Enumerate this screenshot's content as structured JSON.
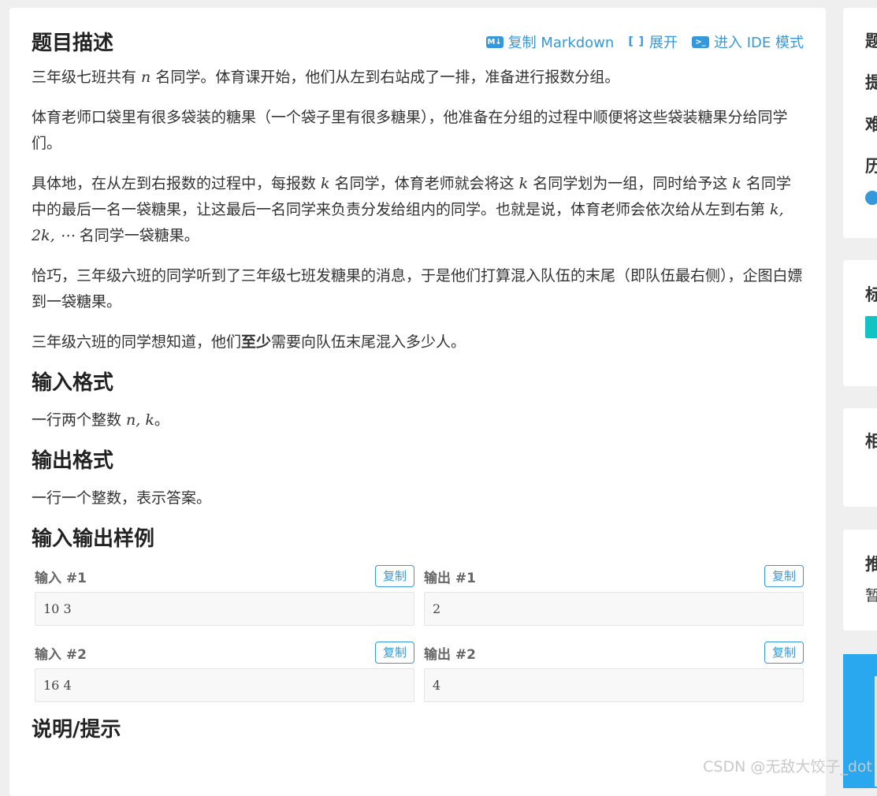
{
  "problem": {
    "title": "题目描述",
    "actions": {
      "copy_markdown": "复制 Markdown",
      "md_icon": "M↓",
      "expand": "展开",
      "expand_icon": "[ ]",
      "ide_mode": "进入 IDE 模式",
      "ide_icon": ">_"
    },
    "p1": {
      "a": "三年级七班共有 ",
      "n": "n",
      "b": " 名同学。体育课开始，他们从左到右站成了一排，准备进行报数分组。"
    },
    "p2": "体育老师口袋里有很多袋装的糖果（一个袋子里有很多糖果），他准备在分组的过程中顺便将这些袋装糖果分给同学们。",
    "p3": {
      "a": "具体地，在从左到右报数的过程中，每报数 ",
      "k1": "k",
      "b": " 名同学，体育老师就会将这 ",
      "k2": "k",
      "c": " 名同学划为一组，同时给予这 ",
      "k3": "k",
      "d": " 名同学中的最后一名一袋糖果，让这最后一名同学来负责分发给组内的同学。也就是说，体育老师会依次给从左到右第 ",
      "seq": "k, 2k, ⋯",
      "e": " 名同学一袋糖果。"
    },
    "p4": "恰巧，三年级六班的同学听到了三年级七班发糖果的消息，于是他们打算混入队伍的末尾（即队伍最右侧），企图白嫖到一袋糖果。",
    "p5": {
      "a": "三年级六班的同学想知道，他们",
      "bold": "至少",
      "b": "需要向队伍末尾混入多少人。"
    },
    "input_title": "输入格式",
    "input_text": {
      "a": "一行两个整数 ",
      "m": "n, k",
      "b": "。"
    },
    "output_title": "输出格式",
    "output_text": "一行一个整数，表示答案。",
    "examples_title": "输入输出样例",
    "examples": [
      {
        "in_label": "输入 #1",
        "in_value": "10 3",
        "out_label": "输出 #1",
        "out_value": "2"
      },
      {
        "in_label": "输入 #2",
        "in_value": "16 4",
        "out_label": "输出 #2",
        "out_value": "4"
      }
    ],
    "copy_label": "复制",
    "hint_title": "说明/提示"
  },
  "sidebar": {
    "card1_lines": [
      "题",
      "提",
      "难",
      "历"
    ],
    "card2": "标",
    "card3": "相",
    "card4": "推",
    "card4_sub": "暂"
  },
  "watermark": "CSDN @无敌大饺子_dot"
}
